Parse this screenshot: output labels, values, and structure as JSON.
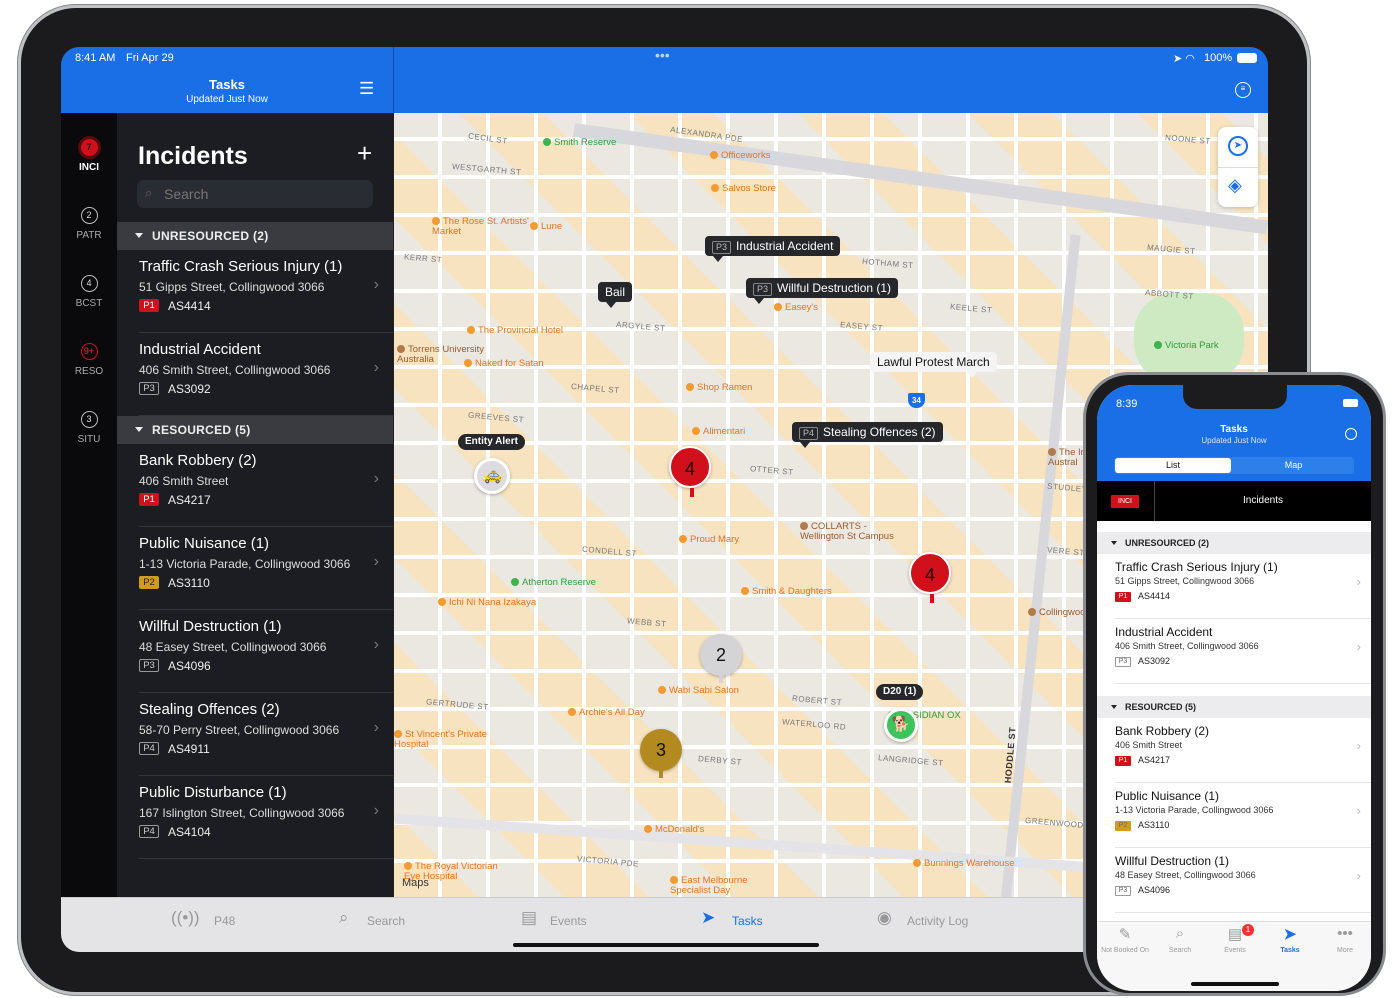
{
  "ipad": {
    "status": {
      "time": "8:41 AM",
      "date": "Fri Apr 29",
      "battery": "100%",
      "more": "•••"
    },
    "header": {
      "title": "Tasks",
      "subtitle": "Updated Just Now",
      "list_icon": "list-icon",
      "filter_icon": "filter-icon"
    },
    "rail": [
      {
        "count": "7",
        "label": "INCI",
        "active": true
      },
      {
        "count": "2",
        "label": "PATR"
      },
      {
        "count": "4",
        "label": "BCST"
      },
      {
        "count": "9+",
        "label": "RESO",
        "alert": true
      },
      {
        "count": "3",
        "label": "SITU"
      }
    ],
    "panel": {
      "title": "Incidents",
      "add_icon": "plus-icon",
      "search_placeholder": "Search",
      "sections": [
        {
          "label": "UNRESOURCED (2)",
          "items": [
            {
              "title": "Traffic Crash Serious Injury (1)",
              "address": "51 Gipps Street, Collingwood 3066",
              "priority": "P1",
              "id": "AS4414"
            },
            {
              "title": "Industrial Accident",
              "address": "406 Smith Street, Collingwood 3066",
              "priority": "P3",
              "id": "AS3092"
            }
          ]
        },
        {
          "label": "RESOURCED (5)",
          "items": [
            {
              "title": "Bank Robbery (2)",
              "address": "406 Smith Street",
              "priority": "P1",
              "id": "AS4217"
            },
            {
              "title": "Public Nuisance (1)",
              "address": "1-13 Victoria Parade, Collingwood 3066",
              "priority": "P2",
              "id": "AS3110"
            },
            {
              "title": "Willful Destruction (1)",
              "address": "48 Easey Street, Collingwood 3066",
              "priority": "P3",
              "id": "AS4096"
            },
            {
              "title": "Stealing Offences (2)",
              "address": "58-70 Perry Street, Collingwood 3066",
              "priority": "P4",
              "id": "AS4911"
            },
            {
              "title": "Public Disturbance (1)",
              "address": "167 Islington Street, Collingwood 3066",
              "priority": "P4",
              "id": "AS4104"
            }
          ]
        }
      ]
    },
    "map": {
      "callouts": [
        {
          "priority": "P3",
          "text": "Industrial Accident"
        },
        {
          "text": "Bail"
        },
        {
          "priority": "P3",
          "text": "Willful Destruction (1)"
        },
        {
          "text": "Lawful Protest March"
        },
        {
          "priority": "P4",
          "text": "Stealing Offences (2)"
        },
        {
          "text": "Entity Alert"
        },
        {
          "text": "D20 (1)"
        }
      ],
      "clusters": [
        {
          "count": "4",
          "color": "#d0101b"
        },
        {
          "count": "4",
          "color": "#d0101b"
        },
        {
          "count": "2",
          "color": "#d4d4d6"
        },
        {
          "count": "3",
          "color": "#b38a1f"
        }
      ],
      "pois": [
        {
          "text": "Smith Reserve",
          "kind": "park"
        },
        {
          "text": "Officeworks",
          "kind": "shop"
        },
        {
          "text": "Salvos Store",
          "kind": "shop"
        },
        {
          "text": "The Rose St. Artists' Market",
          "kind": "shop"
        },
        {
          "text": "Lune",
          "kind": "shop"
        },
        {
          "text": "The Provincial Hotel",
          "kind": "shop"
        },
        {
          "text": "Torrens University Australia",
          "kind": "edu"
        },
        {
          "text": "Naked for Satan",
          "kind": "shop"
        },
        {
          "text": "Easey's",
          "kind": "shop"
        },
        {
          "text": "Shop Ramen",
          "kind": "shop"
        },
        {
          "text": "Alimentari",
          "kind": "shop"
        },
        {
          "text": "COLLARTS - Wellington St Campus",
          "kind": "edu"
        },
        {
          "text": "Proud Mary",
          "kind": "shop"
        },
        {
          "text": "Smith & Daughters",
          "kind": "shop"
        },
        {
          "text": "Atherton Reserve",
          "kind": "park"
        },
        {
          "text": "Ichi Ni Nana Izakaya",
          "kind": "shop"
        },
        {
          "text": "Wabi Sabi Salon",
          "kind": "shop"
        },
        {
          "text": "Archie's All Day",
          "kind": "shop"
        },
        {
          "text": "OBSIDIAN OX",
          "kind": "park"
        },
        {
          "text": "McDonald's",
          "kind": "shop"
        },
        {
          "text": "Bunnings Warehouse",
          "kind": "shop"
        },
        {
          "text": "Victoria Park",
          "kind": "park"
        },
        {
          "text": "St Vincent's Private Hospital",
          "kind": "shop"
        },
        {
          "text": "East Melbourne Specialist Day",
          "kind": "shop"
        },
        {
          "text": "The Royal Victorian Eye Hospital",
          "kind": "shop"
        },
        {
          "text": "Collingwood Town Hall",
          "kind": "edu"
        },
        {
          "text": "The Imp College Austral",
          "kind": "edu"
        }
      ],
      "streets": [
        "ALEXANDRA PDE",
        "CECIL ST",
        "WESTGARTH ST",
        "KERR ST",
        "HOTHAM ST",
        "ARGYLE ST",
        "KEELE ST",
        "EASEY ST",
        "CHAPEL ST",
        "GREEVES ST",
        "OTTER ST",
        "CONDELL ST",
        "WEBB ST",
        "GERTRUDE ST",
        "ROBERT ST",
        "WATERLOO RD",
        "DERBY ST",
        "LANGRIDGE ST",
        "VICTORIA PDE",
        "HODDLE ST",
        "GREENWOOD ST",
        "MAUGIE ST",
        "ABBOTT ST",
        "STUDLEY ST",
        "NOONE ST",
        "VERE ST"
      ],
      "highway_shield": "34",
      "attribution": "Maps",
      "controls": [
        "location-arrow-icon",
        "layers-icon"
      ]
    },
    "tabs": [
      {
        "label": "P48",
        "icon": "radio-icon"
      },
      {
        "label": "Search",
        "icon": "search-icon"
      },
      {
        "label": "Events",
        "icon": "clipboard-icon"
      },
      {
        "label": "Tasks",
        "icon": "navigation-icon",
        "active": true
      },
      {
        "label": "Activity Log",
        "icon": "person-icon"
      }
    ]
  },
  "phone": {
    "status": {
      "time": "8:39"
    },
    "header": {
      "title": "Tasks",
      "subtitle": "Updated Just Now"
    },
    "segments": [
      "List",
      "Map"
    ],
    "bar": {
      "badge": "INCI",
      "title": "Incidents"
    },
    "sections": [
      {
        "label": "UNRESOURCED (2)",
        "items": [
          {
            "title": "Traffic Crash Serious Injury (1)",
            "address": "51 Gipps Street, Collingwood 3066",
            "priority": "P1",
            "id": "AS4414"
          },
          {
            "title": "Industrial Accident",
            "address": "406 Smith Street, Collingwood 3066",
            "priority": "P3",
            "id": "AS3092"
          }
        ]
      },
      {
        "label": "RESOURCED (5)",
        "items": [
          {
            "title": "Bank Robbery (2)",
            "address": "406 Smith Street",
            "priority": "P1",
            "id": "AS4217"
          },
          {
            "title": "Public Nuisance (1)",
            "address": "1-13 Victoria Parade, Collingwood 3066",
            "priority": "P2",
            "id": "AS3110"
          },
          {
            "title": "Willful Destruction (1)",
            "address": "48 Easey Street, Collingwood 3066",
            "priority": "P3",
            "id": "AS4096"
          }
        ]
      }
    ],
    "tabs": [
      {
        "label": "Not Booked On"
      },
      {
        "label": "Search"
      },
      {
        "label": "Events",
        "badge": "1"
      },
      {
        "label": "Tasks",
        "active": true
      },
      {
        "label": "More"
      }
    ]
  },
  "colors": {
    "accent": "#1a6fe6",
    "p1": "#d0101b",
    "p2": "#d39b1a",
    "dog": "#3fc25a"
  }
}
